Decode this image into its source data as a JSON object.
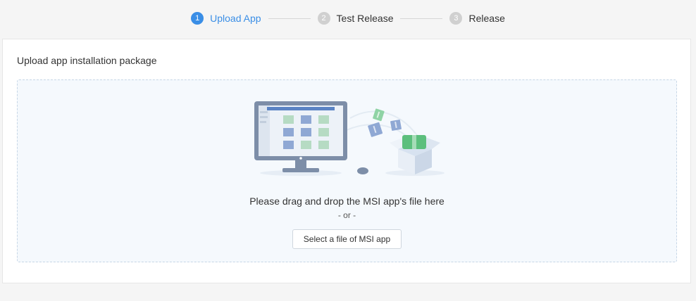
{
  "steps": [
    {
      "number": "1",
      "label": "Upload App",
      "state": "active"
    },
    {
      "number": "2",
      "label": "Test Release",
      "state": "pending"
    },
    {
      "number": "3",
      "label": "Release",
      "state": "pending"
    }
  ],
  "panel": {
    "title": "Upload app installation package",
    "dropzone": {
      "instruction": "Please drag and drop the MSI app's file here",
      "or_text": "- or -",
      "select_button_label": "Select a file of MSI app"
    }
  },
  "colors": {
    "accent": "#3a8ee6",
    "inactive_step": "#d0d0d0",
    "dropzone_bg": "#f5f9fd"
  },
  "icons": {
    "illustration": "computer-upload-to-box-illustration"
  }
}
